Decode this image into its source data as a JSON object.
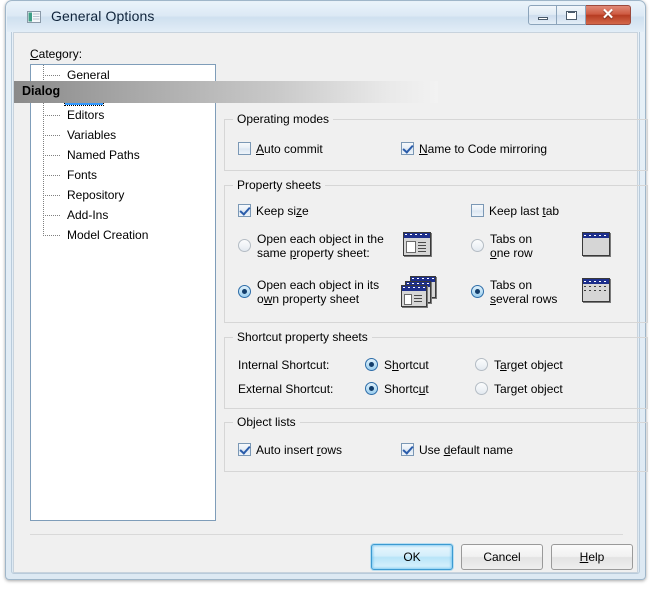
{
  "window": {
    "title": "General Options",
    "icon": "options-document-icon",
    "controls": {
      "minimize": "minimize-button",
      "maximize": "maximize-button",
      "close": "close-button",
      "close_glyph": "✕"
    },
    "close_color": "#b63c22",
    "accent_color": "#3399ff"
  },
  "sidebar": {
    "label": "Category:",
    "label_accesskey": "C",
    "items": [
      {
        "label": "General",
        "selected": false
      },
      {
        "label": "Dialog",
        "selected": true
      },
      {
        "label": "Editors",
        "selected": false
      },
      {
        "label": "Variables",
        "selected": false
      },
      {
        "label": "Named Paths",
        "selected": false
      },
      {
        "label": "Fonts",
        "selected": false
      },
      {
        "label": "Repository",
        "selected": false
      },
      {
        "label": "Add-Ins",
        "selected": false
      },
      {
        "label": "Model Creation",
        "selected": false
      }
    ]
  },
  "panel": {
    "header": "Dialog",
    "groups": {
      "operating_modes": {
        "title": "Operating modes",
        "checkboxes": [
          {
            "pre": "",
            "key": "A",
            "post": "uto commit",
            "checked": false
          },
          {
            "pre": "",
            "key": "N",
            "post": "ame to Code mirroring",
            "checked": true
          }
        ]
      },
      "property_sheets": {
        "title": "Property sheets",
        "checkboxes": [
          {
            "pre": "Keep si",
            "key": "z",
            "post": "e",
            "checked": true
          },
          {
            "pre": "Keep last ",
            "key": "t",
            "post": "ab",
            "checked": false
          }
        ],
        "radios_left": [
          {
            "line1": "Open each object in the",
            "line2_pre": "same ",
            "line2_key": "p",
            "line2_post": "roperty sheet:",
            "selected": false,
            "icon": "single-property-sheet-icon"
          },
          {
            "line1": "Open each object in its",
            "line2_pre": "o",
            "line2_key": "w",
            "line2_post": "n property sheet",
            "selected": true,
            "icon": "multiple-property-sheets-icon"
          }
        ],
        "radios_right": [
          {
            "line1": "Tabs on",
            "line2_pre": "",
            "line2_key": "o",
            "line2_post": "ne row",
            "selected": false,
            "icon": "tabs-one-row-icon"
          },
          {
            "line1": "Tabs on",
            "line2_pre": "",
            "line2_key": "s",
            "line2_post": "everal rows",
            "selected": true,
            "icon": "tabs-several-rows-icon"
          }
        ]
      },
      "shortcut_property_sheets": {
        "title": "Shortcut property sheets",
        "rows": [
          {
            "label": "Internal Shortcut:",
            "option1": {
              "pre": "S",
              "key": "h",
              "post": "ortcut",
              "selected": true
            },
            "option2": {
              "pre": "T",
              "key": "a",
              "post": "rget object",
              "selected": false
            }
          },
          {
            "label": "External Shortcut:",
            "option1": {
              "pre": "Shortc",
              "key": "u",
              "post": "t",
              "selected": true
            },
            "option2": {
              "pre": "Tar",
              "key": "g",
              "post": "et object",
              "selected": false
            }
          }
        ]
      },
      "object_lists": {
        "title": "Object lists",
        "checkboxes": [
          {
            "pre": "Auto insert ",
            "key": "r",
            "post": "ows",
            "checked": true
          },
          {
            "pre": "Use ",
            "key": "d",
            "post": "efault name",
            "checked": true
          }
        ]
      }
    }
  },
  "footer": {
    "ok": "OK",
    "cancel": "Cancel",
    "help_pre": "",
    "help_key": "H",
    "help_post": "elp"
  }
}
